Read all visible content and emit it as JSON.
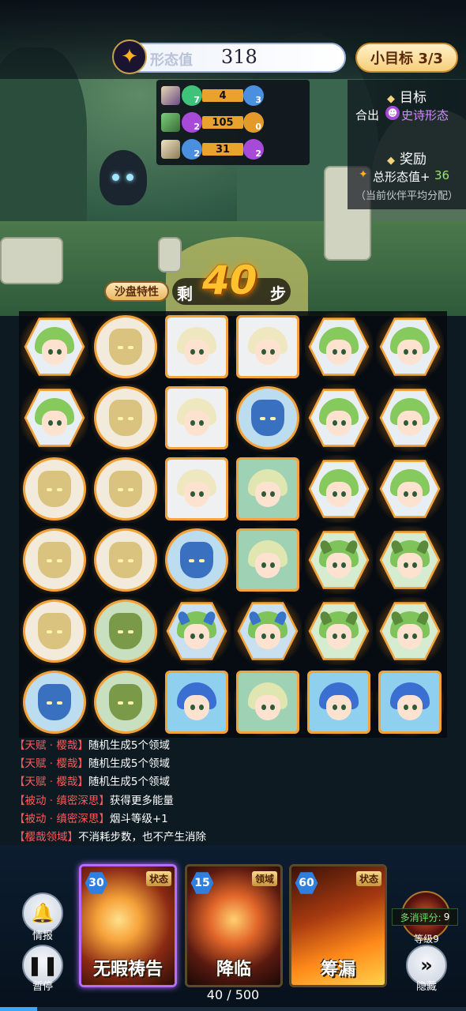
{
  "top": {
    "form_label": "形态值",
    "form_value": "318",
    "goal_label": "小目标 3/3"
  },
  "moves": [
    {
      "left_count": "7",
      "bar": "4",
      "right_count": "3",
      "left_color": "#3fc27a",
      "right_color": "#4a8fe0"
    },
    {
      "left_count": "2",
      "bar": "105",
      "right_count": "0",
      "left_color": "#a74ad8",
      "right_color": "#e39a2a"
    },
    {
      "left_count": "2",
      "bar": "31",
      "right_count": "2",
      "left_color": "#4a8fe0",
      "right_color": "#a74ad8"
    }
  ],
  "objective": {
    "target_title": "目标",
    "target_prefix": "合出",
    "target_value": "史诗形态",
    "reward_title": "奖励",
    "reward_label": "总形态值+",
    "reward_value": "36",
    "reward_note": "（当前伙伴平均分配）"
  },
  "steps": {
    "sandbox_button": "沙盘特性",
    "prefix": "剩",
    "count": "40",
    "suffix": "步"
  },
  "board": {
    "rows": [
      [
        "elf",
        "beast",
        "knight",
        "knight",
        "elf",
        "elf"
      ],
      [
        "elf",
        "beast",
        "knight",
        "bluebeast",
        "elf",
        "elf"
      ],
      [
        "beast",
        "beast",
        "knight",
        "leafgirl",
        "elf",
        "elf"
      ],
      [
        "beast",
        "beast",
        "bluebeast",
        "leafgirl",
        "horngirl",
        "horngirl"
      ],
      [
        "beast",
        "greenbeast",
        "blueram",
        "blueram",
        "horngirl",
        "horngirl"
      ],
      [
        "bluebeast",
        "greenbeast",
        "bluehelm",
        "leafgirl",
        "bluehelm",
        "bluehelm"
      ]
    ]
  },
  "log": [
    {
      "tag": "【天赋 · 樱哉】",
      "text": "随机生成5个领域"
    },
    {
      "tag": "【天赋 · 樱哉】",
      "text": "随机生成5个领域"
    },
    {
      "tag": "【天赋 · 樱哉】",
      "text": "随机生成5个领域"
    },
    {
      "tag": "【被动 · 缜密深思】",
      "text": "获得更多能量"
    },
    {
      "tag": "【被动 · 缜密深思】",
      "text": "烟斗等级+1"
    },
    {
      "tag": "【樱哉领域】",
      "text": "不消耗步数，也不产生消除"
    }
  ],
  "buttons": {
    "info_label": "情报",
    "pause_label": "暂停",
    "hide_label": "隐藏"
  },
  "cards": [
    {
      "cost": "30",
      "type": "状态",
      "name": "无暇祷告",
      "selected": true,
      "colors": [
        "#5a1c14",
        "#f6a23a"
      ]
    },
    {
      "cost": "15",
      "type": "领域",
      "name": "降临",
      "selected": false,
      "colors": [
        "#2a0e0a",
        "#e3672a"
      ]
    },
    {
      "cost": "60",
      "type": "状态",
      "name": "筹漏",
      "selected": false,
      "colors": [
        "#3a1208",
        "#ff8a1a"
      ]
    }
  ],
  "combo": {
    "label": "多消评分:",
    "value": "9",
    "level": "等级9"
  },
  "progress": {
    "text": "40 / 500",
    "fraction": 0.08
  }
}
